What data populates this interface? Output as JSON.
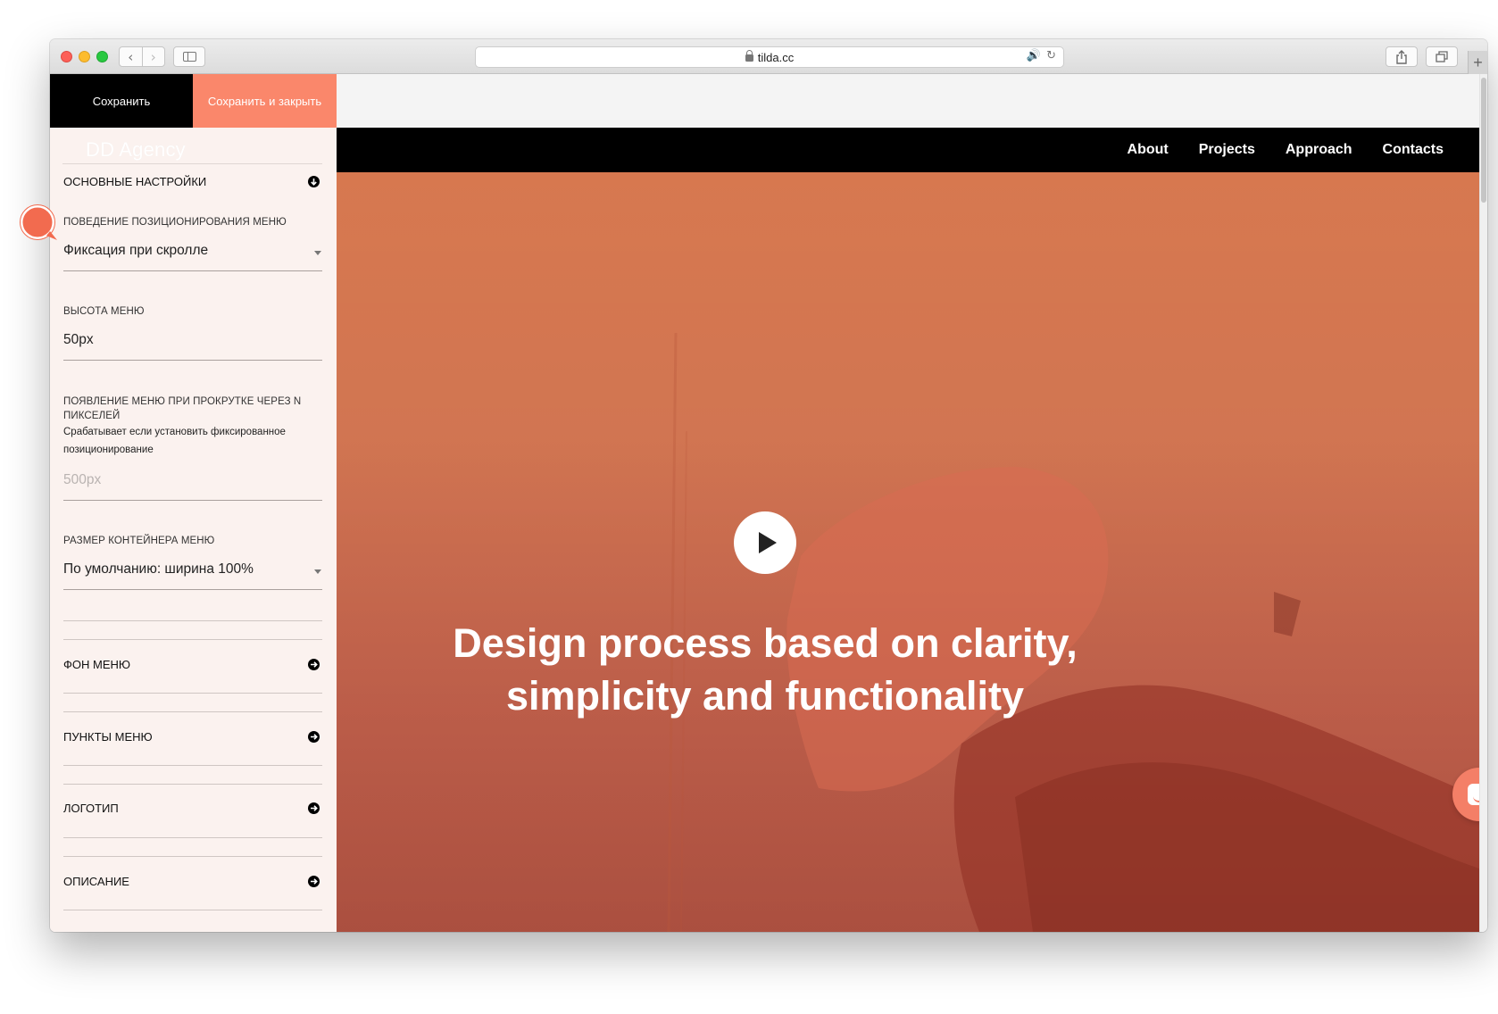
{
  "browser": {
    "url": "tilda.cc",
    "nav_back": "‹",
    "nav_forward": "›",
    "new_tab": "+"
  },
  "editor": {
    "save_label": "Сохранить",
    "save_close_label": "Сохранить и закрыть",
    "ghost_title": "DD Agency",
    "main_section": "ОСНОВНЫЕ НАСТРОЙКИ",
    "fields": {
      "position_behavior": {
        "label": "ПОВЕДЕНИЕ ПОЗИЦИОНИРОВАНИЯ МЕНЮ",
        "value": "Фиксация при скролле"
      },
      "menu_height": {
        "label": "ВЫСОТА МЕНЮ",
        "value": "50px"
      },
      "appear_offset": {
        "label": "ПОЯВЛЕНИЕ МЕНЮ ПРИ ПРОКРУТКЕ ЧЕРЕЗ N ПИКСЕЛЕЙ",
        "hint": "Срабатывает если установить фиксированное позиционирование",
        "placeholder": "500px"
      },
      "container_size": {
        "label": "РАЗМЕР КОНТЕЙНЕРА МЕНЮ",
        "value": "По умолчанию: ширина 100%"
      }
    },
    "sections": [
      {
        "label": "ФОН МЕНЮ"
      },
      {
        "label": "ПУНКТЫ МЕНЮ"
      },
      {
        "label": "ЛОГОТИП"
      },
      {
        "label": "ОПИСАНИЕ"
      }
    ]
  },
  "preview": {
    "menu_items": [
      "About",
      "Projects",
      "Approach",
      "Contacts"
    ],
    "hero_title_line1": "Design process based on clarity,",
    "hero_title_line2": "simplicity and functionality"
  },
  "colors": {
    "accent": "#fa876b",
    "menu_bg": "#000000",
    "hero": "#d7784f"
  },
  "icons": {
    "section_toggle": "arrow-circle-icon",
    "play": "play-icon",
    "chat": "chat-icon"
  }
}
